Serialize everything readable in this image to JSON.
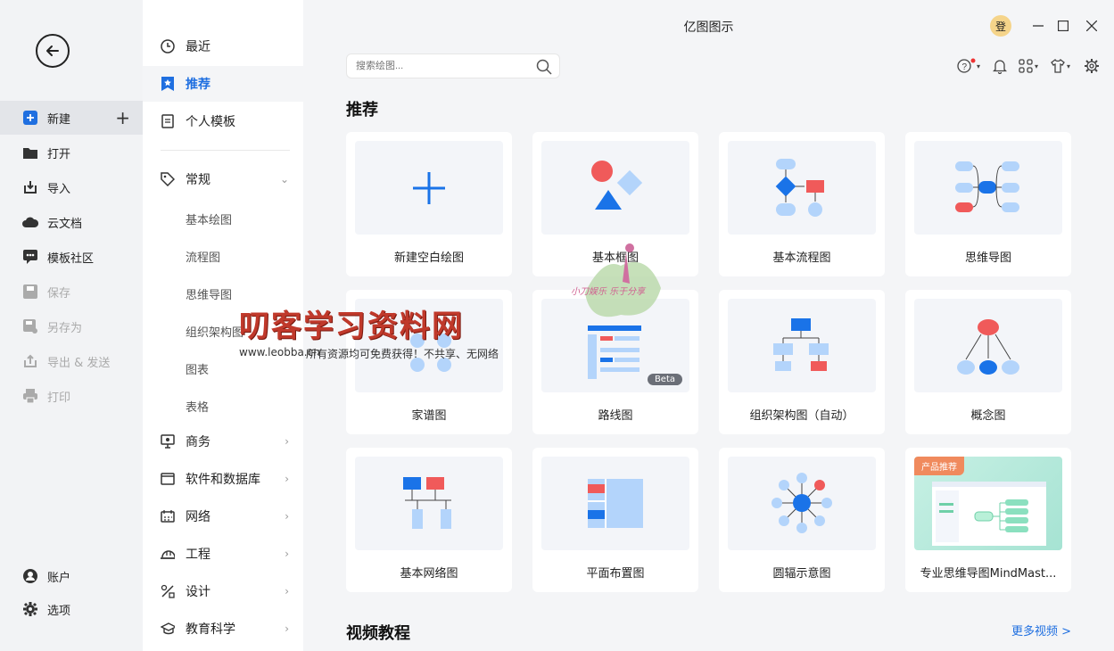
{
  "app": {
    "title": "亿图图示"
  },
  "rail": {
    "items": [
      {
        "label": "新建"
      },
      {
        "label": "打开"
      },
      {
        "label": "导入"
      },
      {
        "label": "云文档"
      },
      {
        "label": "模板社区"
      },
      {
        "label": "保存"
      },
      {
        "label": "另存为"
      },
      {
        "label": "导出 & 发送"
      },
      {
        "label": "打印"
      },
      {
        "label": "账户"
      },
      {
        "label": "选项"
      }
    ]
  },
  "cats": {
    "recent": "最近",
    "recommend": "推荐",
    "personal": "个人模板",
    "general": "常规",
    "general_subs": [
      "基本绘图",
      "流程图",
      "思维导图",
      "组织架构图",
      "图表",
      "表格"
    ],
    "groups": [
      "商务",
      "软件和数据库",
      "网络",
      "工程",
      "设计",
      "教育科学"
    ]
  },
  "search": {
    "placeholder": "搜索绘图..."
  },
  "user": {
    "avatar_text": "登"
  },
  "main": {
    "recommend_title": "推荐",
    "video_title": "视频教程",
    "more_videos": "更多视频 >",
    "cards": [
      {
        "label": "新建空白绘图"
      },
      {
        "label": "基本框图"
      },
      {
        "label": "基本流程图"
      },
      {
        "label": "思维导图"
      },
      {
        "label": "家谱图"
      },
      {
        "label": "路线图",
        "badge": "Beta"
      },
      {
        "label": "组织架构图（自动）"
      },
      {
        "label": "概念图"
      },
      {
        "label": "基本网络图"
      },
      {
        "label": "平面布置图"
      },
      {
        "label": "圆辐示意图"
      },
      {
        "label": "专业思维导图MindMast...",
        "badge": "产品推荐"
      }
    ]
  },
  "watermark": {
    "title": "叨客学习资料网",
    "url": "www.leobba.cn",
    "note": "所有资源均可免费获得！不共享、无网络",
    "logo_text": "小刀娱乐 乐于分享"
  },
  "colors": {
    "accent": "#1f6fe0",
    "red": "#f05a5a",
    "light_blue": "#b3d4fb",
    "blue": "#1a73e8"
  }
}
